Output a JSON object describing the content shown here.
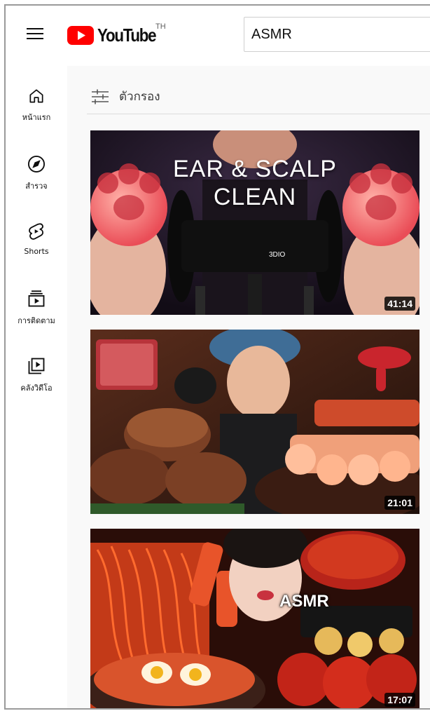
{
  "header": {
    "logo_text": "YouTube",
    "country_code": "TH",
    "search_value": "ASMR"
  },
  "sidebar": {
    "items": [
      {
        "label": "หน้าแรก",
        "icon": "home-icon"
      },
      {
        "label": "สำรวจ",
        "icon": "compass-icon"
      },
      {
        "label": "Shorts",
        "icon": "shorts-icon"
      },
      {
        "label": "การติดตาม",
        "icon": "subscriptions-icon"
      },
      {
        "label": "คลังวิดีโอ",
        "icon": "library-icon"
      }
    ]
  },
  "filter": {
    "label": "ตัวกรอง",
    "icon": "filter-sliders-icon"
  },
  "videos": [
    {
      "duration": "41:14",
      "thumbnail_text_line1": "EAR & SCALP",
      "thumbnail_text_line2": "CLEAN",
      "mic_brand": "3DIO"
    },
    {
      "duration": "21:01"
    },
    {
      "duration": "17:07",
      "thumbnail_text": "ASMR"
    }
  ],
  "colors": {
    "brand_red": "#ff0000",
    "content_bg": "#f9f9f9"
  }
}
